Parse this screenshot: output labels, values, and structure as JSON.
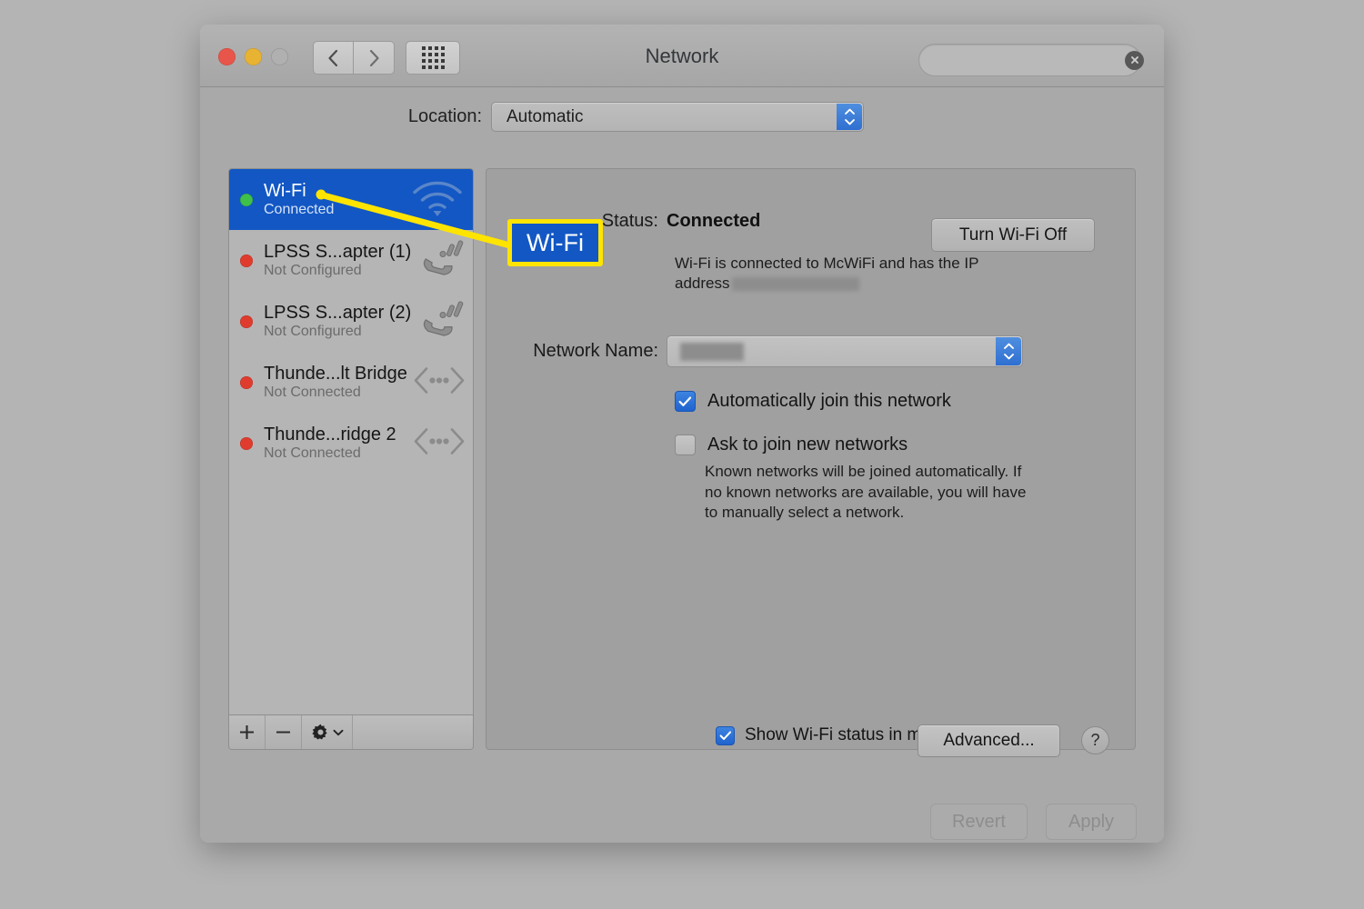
{
  "window": {
    "title": "Network",
    "traffic_lights": [
      "close-red",
      "minimize-yellow",
      "zoom-disabled"
    ],
    "nav": {
      "back": "back-chevron",
      "forward": "forward-chevron",
      "show_all": "grid-of-dots"
    },
    "search": {
      "value": "",
      "placeholder": "",
      "icon": "search-icon",
      "clear": "clear-icon"
    }
  },
  "location": {
    "label": "Location:",
    "value": "Automatic",
    "options": [
      "Automatic"
    ]
  },
  "sidebar": {
    "items": [
      {
        "name": "Wi-Fi",
        "status": "Connected",
        "dot": "green",
        "icon": "wifi-icon",
        "selected": true
      },
      {
        "name": "LPSS S...apter (1)",
        "status": "Not Configured",
        "dot": "red",
        "icon": "modem-icon",
        "selected": false
      },
      {
        "name": "LPSS S...apter (2)",
        "status": "Not Configured",
        "dot": "red",
        "icon": "modem-icon",
        "selected": false
      },
      {
        "name": "Thunde...lt Bridge",
        "status": "Not Connected",
        "dot": "red",
        "icon": "thunderbolt-icon",
        "selected": false
      },
      {
        "name": "Thunde...ridge 2",
        "status": "Not Connected",
        "dot": "red",
        "icon": "thunderbolt-icon",
        "selected": false
      }
    ],
    "toolbar": {
      "add": "+",
      "remove": "−",
      "actions": "gear-icon",
      "actions_chevron": "chevron-down-icon"
    }
  },
  "panel": {
    "status_label": "Status:",
    "status_value": "Connected",
    "toggle_button": "Turn Wi-Fi Off",
    "status_description_prefix": "Wi-Fi is connected to McWiFi and has the IP address",
    "status_description_redacted": true,
    "network_name_label": "Network Name:",
    "network_name_value": "",
    "network_name_redacted": true,
    "checkboxes": [
      {
        "label": "Automatically join this network",
        "checked": true
      },
      {
        "label": "Ask to join new networks",
        "checked": false
      }
    ],
    "hint": "Known networks will be joined automatically. If no known networks are available, you will have to manually select a network.",
    "show_status_checkbox": {
      "label": "Show Wi-Fi status in menu bar",
      "checked": true
    },
    "advanced_button": "Advanced...",
    "help_button": "?"
  },
  "footer": {
    "revert_button": "Revert",
    "apply_button": "Apply",
    "revert_enabled": false,
    "apply_enabled": false
  },
  "annotation": {
    "callout_label": "Wi-Fi",
    "callout_border_color": "#ffe400",
    "callout_fill_color": "#1257c4",
    "pointer_line_color": "#ffe400"
  },
  "colors": {
    "desktop": "#b4b4b4",
    "window_body": "#a9a9a9",
    "sidebar": "#b5b5b5",
    "panel": "#a0a0a0",
    "selection_blue": "#1257c4",
    "status_green": "#3fc04a",
    "status_red": "#e03c2e",
    "accent_blue": "#2f6fd0"
  }
}
